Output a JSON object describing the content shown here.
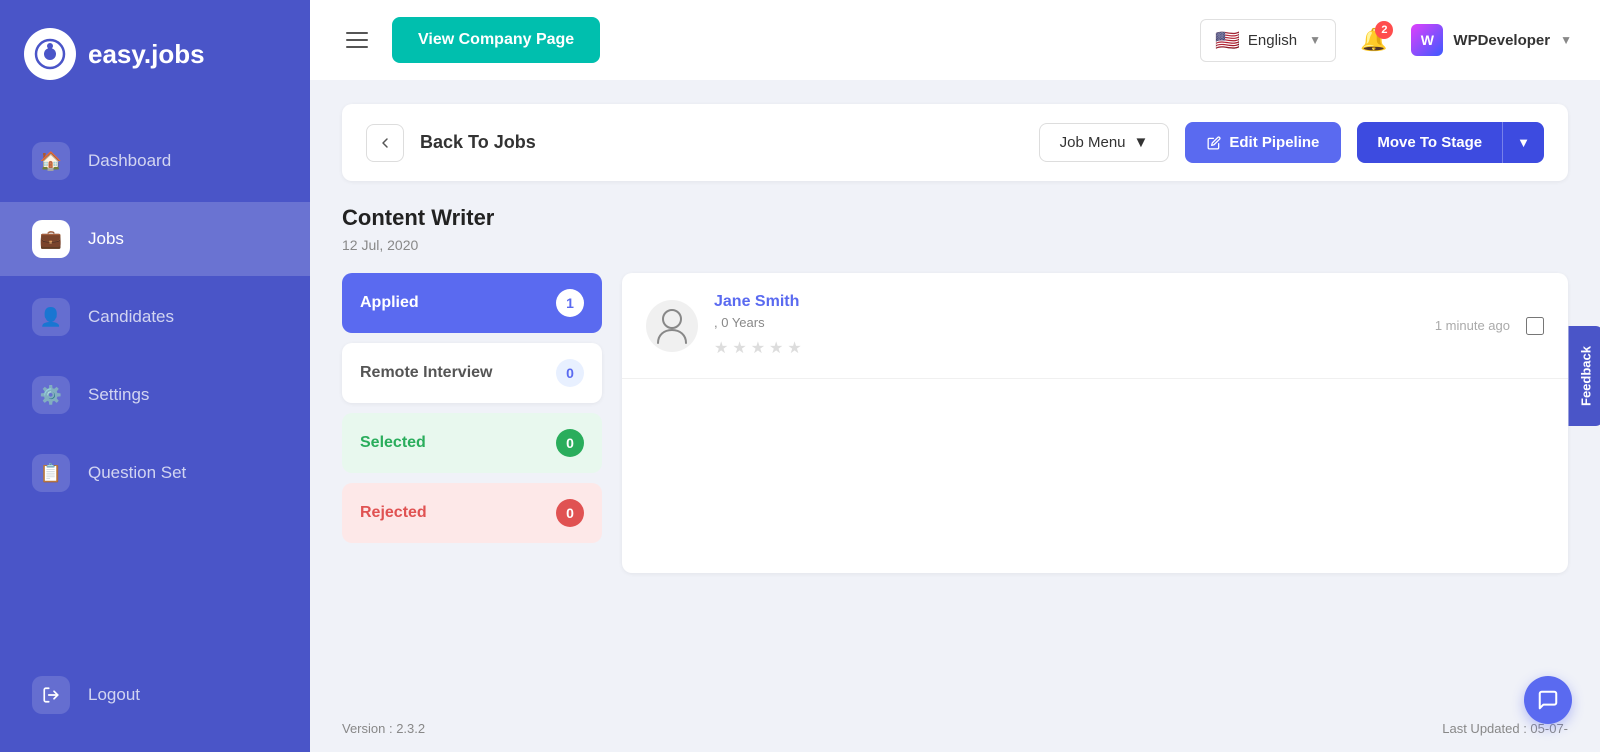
{
  "app": {
    "name": "easy.jobs",
    "logo_letter": "i"
  },
  "sidebar": {
    "nav_items": [
      {
        "id": "dashboard",
        "label": "Dashboard",
        "icon": "🏠",
        "active": false
      },
      {
        "id": "jobs",
        "label": "Jobs",
        "icon": "💼",
        "active": true
      },
      {
        "id": "candidates",
        "label": "Candidates",
        "icon": "👤",
        "active": false
      },
      {
        "id": "settings",
        "label": "Settings",
        "icon": "⚙️",
        "active": false
      },
      {
        "id": "question-set",
        "label": "Question Set",
        "icon": "📋",
        "active": false
      }
    ],
    "logout_label": "Logout"
  },
  "header": {
    "view_company_label": "View Company Page",
    "language": "English",
    "notification_count": "2",
    "user_name": "WPDeveloper"
  },
  "back_bar": {
    "back_label": "Back To Jobs",
    "job_menu_label": "Job Menu",
    "edit_pipeline_label": "Edit Pipeline",
    "move_stage_label": "Move To Stage"
  },
  "job": {
    "title": "Content Writer",
    "date": "12 Jul, 2020"
  },
  "pipeline_stages": [
    {
      "id": "applied",
      "label": "Applied",
      "count": "1",
      "type": "applied"
    },
    {
      "id": "remote-interview",
      "label": "Remote Interview",
      "count": "0",
      "type": "remote-interview"
    },
    {
      "id": "selected",
      "label": "Selected",
      "count": "0",
      "type": "selected"
    },
    {
      "id": "rejected",
      "label": "Rejected",
      "count": "0",
      "type": "rejected"
    }
  ],
  "candidate": {
    "name": "Jane Smith",
    "experience": ", 0 Years",
    "time_ago": "1 minute ago",
    "stars": [
      false,
      false,
      false,
      false,
      false
    ]
  },
  "footer": {
    "version": "Version : 2.3.2",
    "last_updated": "Last Updated : 05-07-"
  },
  "feedback_label": "Feedback"
}
